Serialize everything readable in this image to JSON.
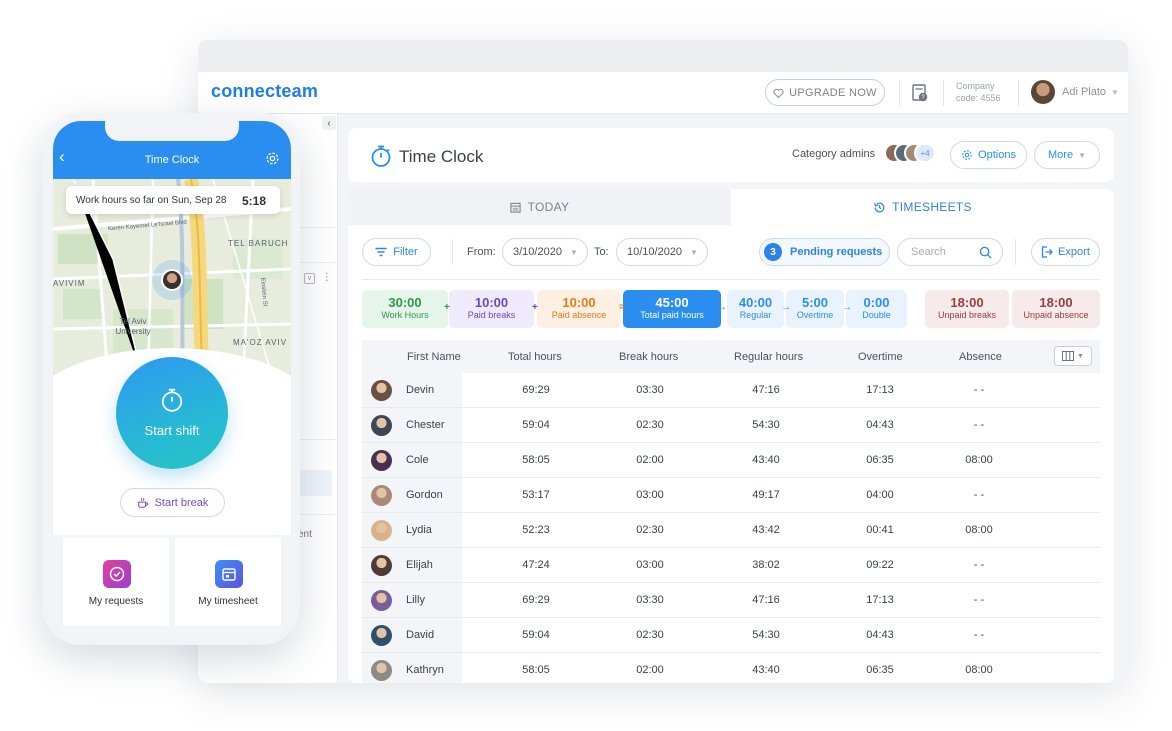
{
  "app": {
    "logo": "connecteam",
    "upgrade_label": "UPGRADE NOW",
    "company_label": "Company",
    "company_code": "code: 4556",
    "user_name": "Adi Plato",
    "sidebar_partial_text": "ent"
  },
  "page": {
    "title": "Time Clock",
    "category_admins_label": "Category admins",
    "admins_more": "+4",
    "options_label": "Options",
    "more_label": "More"
  },
  "tabs": {
    "today": "TODAY",
    "timesheets": "TIMESHEETS",
    "active": "timesheets"
  },
  "filters": {
    "filter_label": "Filter",
    "from_label": "From:",
    "from_value": "3/10/2020",
    "to_label": "To:",
    "to_value": "10/10/2020",
    "pending_count": "3",
    "pending_label": "Pending requests",
    "search_placeholder": "Search",
    "export_label": "Export"
  },
  "summary": [
    {
      "value": "30:00",
      "label": "Work Hours",
      "color": "#2e9a4a",
      "bg": "#e6f5e9"
    },
    {
      "value": "10:00",
      "label": "Paid breaks",
      "color": "#6b46c9",
      "bg": "#efeafc"
    },
    {
      "value": "10:00",
      "label": "Paid absence",
      "color": "#e07c1a",
      "bg": "#fdf0e2"
    },
    {
      "value": "45:00",
      "label": "Total paid hours",
      "color": "#ffffff",
      "bg": "#2a8ef0"
    },
    {
      "value": "40:00",
      "label": "Regular",
      "color": "#2a8ef0",
      "bg": "#e9f3fe"
    },
    {
      "value": "5:00",
      "label": "Overtime",
      "color": "#2a8ef0",
      "bg": "#e9f3fe"
    },
    {
      "value": "0:00",
      "label": "Double",
      "color": "#2a8ef0",
      "bg": "#e9f3fe"
    },
    {
      "value": "18:00",
      "label": "Unpaid breaks",
      "color": "#9b3d3d",
      "bg": "#f7eaea"
    },
    {
      "value": "18:00",
      "label": "Unpaid absence",
      "color": "#9b3d3d",
      "bg": "#f7eaea"
    }
  ],
  "operators": [
    "+",
    "+",
    "=",
    "→",
    "→",
    "→"
  ],
  "table": {
    "headers": [
      "First Name",
      "Total hours",
      "Break hours",
      "Regular hours",
      "Overtime",
      "Absence"
    ],
    "rows": [
      {
        "name": "Devin",
        "total": "69:29",
        "break": "03:30",
        "regular": "47:16",
        "overtime": "17:13",
        "absence": "- -"
      },
      {
        "name": "Chester",
        "total": "59:04",
        "break": "02:30",
        "regular": "54:30",
        "overtime": "04:43",
        "absence": "- -"
      },
      {
        "name": "Cole",
        "total": "58:05",
        "break": "02:00",
        "regular": "43:40",
        "overtime": "06:35",
        "absence": "08:00"
      },
      {
        "name": "Gordon",
        "total": "53:17",
        "break": "03:00",
        "regular": "49:17",
        "overtime": "04:00",
        "absence": "- -"
      },
      {
        "name": "Lydia",
        "total": "52:23",
        "break": "02:30",
        "regular": "43:42",
        "overtime": "00:41",
        "absence": "08:00"
      },
      {
        "name": "Elijah",
        "total": "47:24",
        "break": "03:00",
        "regular": "38:02",
        "overtime": "09:22",
        "absence": "- -"
      },
      {
        "name": "Lilly",
        "total": "69:29",
        "break": "03:30",
        "regular": "47:16",
        "overtime": "17:13",
        "absence": "- -"
      },
      {
        "name": "David",
        "total": "59:04",
        "break": "02:30",
        "regular": "54:30",
        "overtime": "04:43",
        "absence": "- -"
      },
      {
        "name": "Kathryn",
        "total": "58:05",
        "break": "02:00",
        "regular": "43:40",
        "overtime": "06:35",
        "absence": "08:00"
      }
    ]
  },
  "phone": {
    "title": "Time Clock",
    "worked_label": "Work hours so far on Sun, Sep 28",
    "worked_time": "5:18",
    "map_labels": [
      "TEL BARUCH",
      "AVIVIM",
      "Tel Aviv University",
      "MA'OZ AVIV",
      "Keren Kayemet Le'Israel Blvd",
      "Einstein St"
    ],
    "start_shift_label": "Start shift",
    "start_break_label": "Start break",
    "tiles": [
      {
        "label": "My requests",
        "icon": "check-circle-icon"
      },
      {
        "label": "My timesheet",
        "icon": "calendar-icon"
      }
    ]
  }
}
